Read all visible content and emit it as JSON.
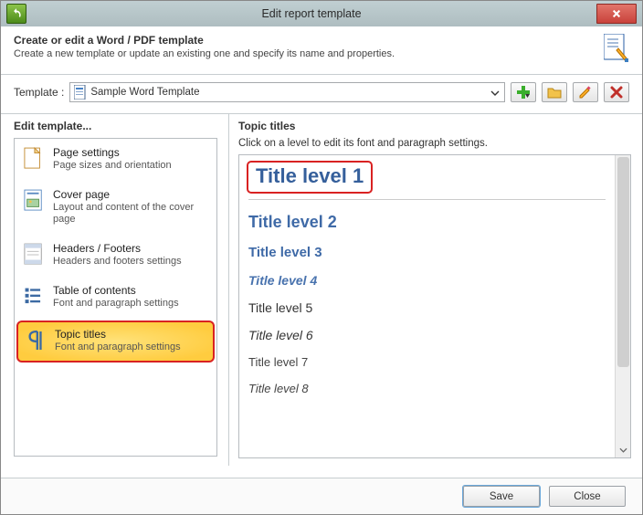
{
  "titlebar": {
    "title": "Edit report template"
  },
  "intro": {
    "heading": "Create or edit a Word / PDF template",
    "sub": "Create a new template or update an existing one and specify its name and properties."
  },
  "template": {
    "label": "Template :",
    "value": "Sample Word Template"
  },
  "left": {
    "title": "Edit template...",
    "items": [
      {
        "title": "Page settings",
        "desc": "Page sizes and orientation"
      },
      {
        "title": "Cover page",
        "desc": "Layout and content of the cover page"
      },
      {
        "title": "Headers / Footers",
        "desc": "Headers and footers settings"
      },
      {
        "title": "Table of contents",
        "desc": "Font and paragraph settings"
      },
      {
        "title": "Topic titles",
        "desc": "Font and paragraph settings"
      }
    ]
  },
  "right": {
    "title": "Topic titles",
    "hint": "Click on a level to edit its font and paragraph settings.",
    "levels": [
      "Title level 1",
      "Title level 2",
      "Title level 3",
      "Title level 4",
      "Title level 5",
      "Title level 6",
      "Title level 7",
      "Title level 8"
    ]
  },
  "footer": {
    "save": "Save",
    "close": "Close"
  }
}
